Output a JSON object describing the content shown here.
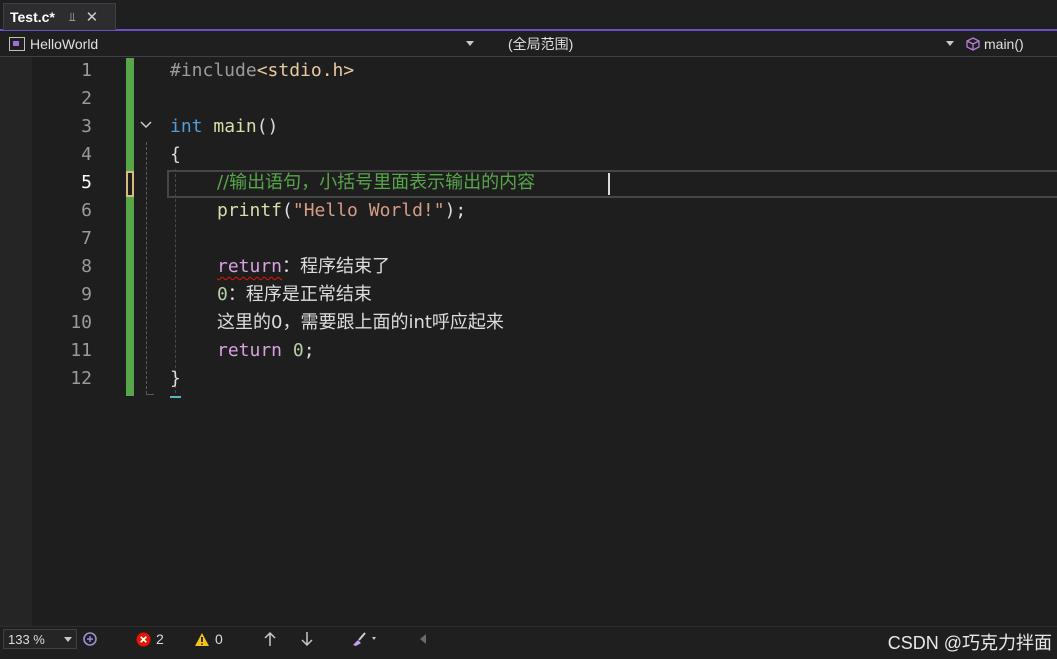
{
  "tab": {
    "title": "Test.c*",
    "pin_glyph": "⫫",
    "close_glyph": "✕"
  },
  "navbar": {
    "project": "HelloWorld",
    "scope": "(全局范围)",
    "member": "main()"
  },
  "editor": {
    "line_numbers": [
      "1",
      "2",
      "3",
      "4",
      "5",
      "6",
      "7",
      "8",
      "9",
      "10",
      "11",
      "12"
    ],
    "current_line": 5,
    "code": {
      "l1_pre": "#include",
      "l1_header": "<stdio.h>",
      "l3_type": "int",
      "l3_name": "main",
      "l3_parens": "()",
      "l4_open": "{",
      "l5_comment": "//输出语句，小括号里面表示输出的内容",
      "l6_fn": "printf",
      "l6_open": "(",
      "l6_string": "\"Hello World!\"",
      "l6_close": ");",
      "l8_return": "return",
      "l8_text": "：程序结束了",
      "l9_num": "0",
      "l9_text": "：程序是正常结束",
      "l10_text": "这里的0，需要跟上面的int呼应起来",
      "l11_return": "return",
      "l11_num": "0",
      "l11_semi": ";",
      "l12_close": "}"
    }
  },
  "statusbar": {
    "zoom": "133 %",
    "errors": "2",
    "warnings": "0",
    "watermark": "CSDN @巧克力拌面"
  },
  "colors": {
    "accent": "#6a4fc7",
    "change_bar": "#57a64a",
    "comment": "#57a64a",
    "keyword": "#569cd6",
    "string": "#d69d85",
    "error": "#e51400"
  },
  "icons": [
    "pin-icon",
    "close-icon",
    "project-icon",
    "dropdown-arrow-icon",
    "cube-icon",
    "fold-toggle-icon",
    "git-icon",
    "error-icon",
    "warning-icon",
    "arrow-up-icon",
    "arrow-down-icon",
    "brush-icon",
    "scroll-left-icon"
  ]
}
